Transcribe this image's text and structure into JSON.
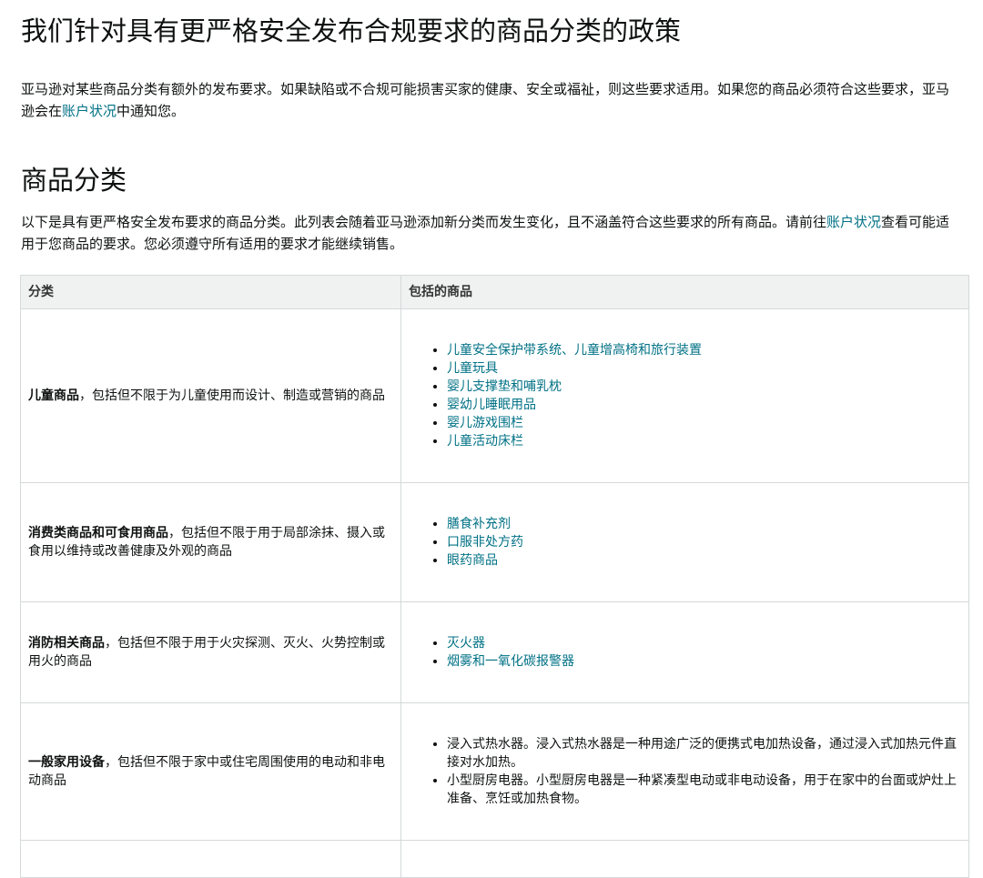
{
  "page_title": "我们针对具有更严格安全发布合规要求的商品分类的政策",
  "intro": {
    "text_before": "亚马逊对某些商品分类有额外的发布要求。如果缺陷或不合规可能损害买家的健康、安全或福祉，则这些要求适用。如果您的商品必须符合这些要求，亚马逊会在",
    "link": "账户状况",
    "text_after": "中通知您。"
  },
  "section_title": "商品分类",
  "section_desc": {
    "text_before": "以下是具有更严格安全发布要求的商品分类。此列表会随着亚马逊添加新分类而发生变化，且不涵盖符合这些要求的所有商品。请前往",
    "link": "账户状况",
    "text_after": "查看可能适用于您商品的要求。您必须遵守所有适用的要求才能继续销售。"
  },
  "table": {
    "headers": [
      "分类",
      "包括的商品"
    ],
    "rows": [
      {
        "cat_bold": "儿童商品",
        "cat_rest": "，包括但不限于为儿童使用而设计、制造或营销的商品",
        "items": [
          "儿童安全保护带系统、儿童增高椅和旅行装置",
          "儿童玩具",
          "婴儿支撑垫和哺乳枕",
          "婴幼儿睡眠用品",
          "婴儿游戏围栏",
          "儿童活动床栏"
        ]
      },
      {
        "cat_bold": "消费类商品和可食用商品",
        "cat_rest": "，包括但不限于用于局部涂抹、摄入或食用以维持或改善健康及外观的商品",
        "items": [
          "膳食补充剂",
          "口服非处方药",
          "眼药商品"
        ]
      },
      {
        "cat_bold": "消防相关商品",
        "cat_rest": "，包括但不限于用于火灾探测、灭火、火势控制或用火的商品",
        "items": [
          "灭火器",
          "烟雾和一氧化碳报警器"
        ]
      },
      {
        "cat_bold": "一般家用设备",
        "cat_rest": "，包括但不限于家中或住宅周围使用的电动和非电动商品",
        "items": [
          "浸入式热水器。浸入式热水器是一种用途广泛的便携式电加热设备，通过浸入式加热元件直接对水加热。",
          "小型厨房电器。小型厨房电器是一种紧凑型电动或非电动设备，用于在家中的台面或炉灶上准备、烹饪或加热食物。"
        ]
      }
    ]
  },
  "colors": {
    "link": "#007185",
    "header_bg": "#f0f2f2",
    "border": "#d5d9d9"
  }
}
